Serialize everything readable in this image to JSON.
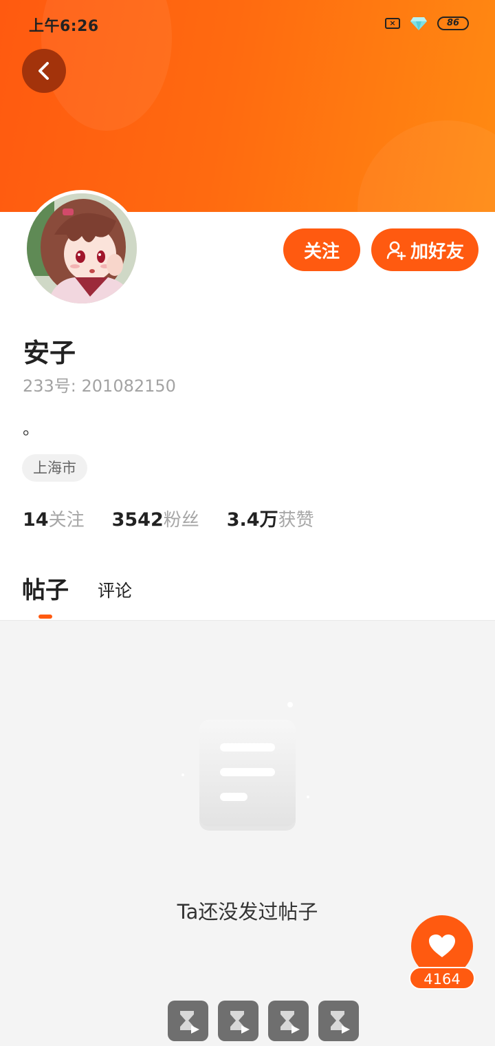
{
  "status_bar": {
    "time": "上午6:26",
    "battery": "86",
    "sim_icon": "sim-missing-icon",
    "vip_icon": "diamond-icon"
  },
  "header": {
    "back_icon": "chevron-left-icon"
  },
  "profile": {
    "avatar_icon": "avatar",
    "nickname": "安子",
    "user_id": "233号: 201082150",
    "bio": "。",
    "location": "上海市",
    "follow_button": "关注",
    "add_friend_button": "加好友",
    "add_friend_icon": "add-user-icon"
  },
  "stats": [
    {
      "value": "14",
      "label": "关注"
    },
    {
      "value": "3542",
      "label": "粉丝"
    },
    {
      "value": "3.4万",
      "label": "获赞"
    }
  ],
  "tabs": {
    "posts": "帖子",
    "comments": "评论"
  },
  "empty_state": {
    "message": "Ta还没发过帖子",
    "icon": "empty-document-icon"
  },
  "like_fab": {
    "icon": "heart-icon",
    "count": "4164"
  },
  "colors": {
    "accent": "#ff5a10",
    "background": "#f4f4f4"
  }
}
